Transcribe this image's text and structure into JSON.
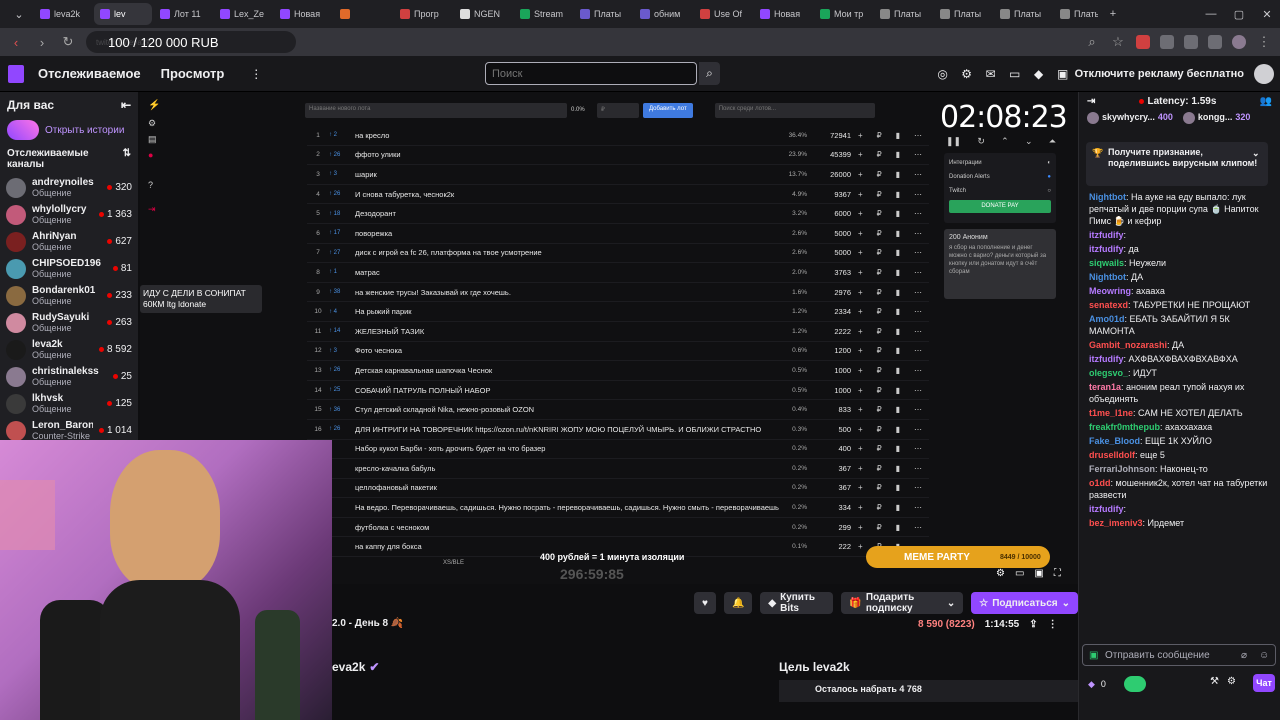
{
  "browser": {
    "tabs": [
      "leva2k",
      "lev",
      "Лот 11",
      "Lex_Ze",
      "Новая",
      "",
      "Прогр",
      "NGEN",
      "Stream",
      "Платы",
      "обним",
      "Use Of",
      "Новая",
      "Мои тр",
      "Платы",
      "Платы",
      "Платы",
      "Платы",
      "Платы",
      "Что хо"
    ],
    "address": "twitch.tv/leva2k",
    "overlay_title": "100 / 120 000 RUB",
    "new_tab": "+"
  },
  "nav": {
    "following": "Отслеживаемое",
    "browse": "Просмотр",
    "search_placeholder": "Поиск",
    "ad_free": "Отключите рекламу бесплатно"
  },
  "sidebar": {
    "for_you": "Для вас",
    "stories": "Открыть истории",
    "followed": "Отслеживаемые каналы",
    "channels": [
      {
        "name": "andreynoiles",
        "cat": "Общение",
        "viewers": "320",
        "color": "#6c6c74"
      },
      {
        "name": "whylollycry",
        "cat": "Общение",
        "viewers": "1 363",
        "color": "#c25a7a"
      },
      {
        "name": "AhriNyan",
        "cat": "Общение",
        "viewers": "627",
        "color": "#7a2020"
      },
      {
        "name": "CHIPSOED196",
        "cat": "Общение",
        "viewers": "81",
        "color": "#4a9ab0"
      },
      {
        "name": "Bondarenk01",
        "cat": "Общение",
        "viewers": "233",
        "color": "#8a6a40"
      },
      {
        "name": "RudySayuki",
        "cat": "Общение",
        "viewers": "263",
        "color": "#d08aa0"
      },
      {
        "name": "leva2k",
        "cat": "Общение",
        "viewers": "8 592",
        "color": "#1a1a1a"
      },
      {
        "name": "christinalekss",
        "cat": "Общение",
        "viewers": "25",
        "color": "#8a7a90"
      },
      {
        "name": "lkhvsk",
        "cat": "Общение",
        "viewers": "125",
        "color": "#3a3a3a"
      },
      {
        "name": "Leron_Baron",
        "cat": "Counter-Strike",
        "viewers": "1 014",
        "color": "#c05050"
      }
    ]
  },
  "stream_overlay": {
    "lot_input": "Название нового лота",
    "pct_default": "0.0%",
    "rub_placeholder": "₽",
    "add_lot": "Добавить лот",
    "lot_search": "Поиск среди лотов...",
    "lots": [
      {
        "n": "1",
        "mini": "↑ 2",
        "name": "на кресло",
        "pct": "36.4%",
        "amt": "72941"
      },
      {
        "n": "2",
        "mini": "↑ 26",
        "name": "ффото улики",
        "pct": "23.9%",
        "amt": "45399"
      },
      {
        "n": "3",
        "mini": "↑ 3",
        "name": "шарик",
        "pct": "13.7%",
        "amt": "26000"
      },
      {
        "n": "4",
        "mini": "↑ 26",
        "name": "И снова табуретка, чеснок2к",
        "pct": "4.9%",
        "amt": "9367"
      },
      {
        "n": "5",
        "mini": "↑ 18",
        "name": "Дезодорант",
        "pct": "3.2%",
        "amt": "6000"
      },
      {
        "n": "6",
        "mini": "↑ 17",
        "name": " поворежка",
        "pct": "2.6%",
        "amt": "5000"
      },
      {
        "n": "7",
        "mini": "↑ 27",
        "name": "диск с игрой еа fc 26, платформа на твое усмотрение",
        "pct": "2.6%",
        "amt": "5000"
      },
      {
        "n": "8",
        "mini": "↑ 1",
        "name": "матрас",
        "pct": "2.0%",
        "amt": "3763"
      },
      {
        "n": "9",
        "mini": "↑ 38",
        "name": "на женские трусы! Заказывай их где хочешь.",
        "pct": "1.6%",
        "amt": "2976"
      },
      {
        "n": "10",
        "mini": "↑ 4",
        "name": "На рыжий парик",
        "pct": "1.2%",
        "amt": "2334"
      },
      {
        "n": "11",
        "mini": "↑ 14",
        "name": "ЖЕЛЕЗНЫЙ ТАЗИК",
        "pct": "1.2%",
        "amt": "2222"
      },
      {
        "n": "12",
        "mini": "↑ 3",
        "name": "Фото чеснока",
        "pct": "0.6%",
        "amt": "1200"
      },
      {
        "n": "13",
        "mini": "↑ 26",
        "name": "Детская карнавальная шапочка Чеснок",
        "pct": "0.5%",
        "amt": "1000"
      },
      {
        "n": "14",
        "mini": "↑ 25",
        "name": "СОБАЧИЙ ПАТРУЛЬ ПОЛНЫЙ НАБОР",
        "pct": "0.5%",
        "amt": "1000"
      },
      {
        "n": "15",
        "mini": "↑ 36",
        "name": "Стул детский складной Nika, нежно-розовый OZON",
        "pct": "0.4%",
        "amt": "833"
      },
      {
        "n": "16",
        "mini": "↑ 26",
        "name": "ДЛЯ ИНТРИГИ НА ТОВОРЕЧНИК https://ozon.ru/t/nKNRIRI ЖОПУ МОЮ ПОЦЕЛУЙ ЧМЫРЬ. И ОБЛИЖИ СТРАСТНО",
        "pct": "0.3%",
        "amt": "500"
      },
      {
        "n": "17",
        "mini": "",
        "name": "Набор кукол Барби - хоть дрочить будет на что бразер",
        "pct": "0.2%",
        "amt": "400"
      },
      {
        "n": "18",
        "mini": "",
        "name": "кресло-качалка бабуль",
        "pct": "0.2%",
        "amt": "367"
      },
      {
        "n": "19",
        "mini": "",
        "name": "целлофановый пакетик",
        "pct": "0.2%",
        "amt": "367"
      },
      {
        "n": "20",
        "mini": "",
        "name": "На ведро. Переворачиваешь, садишься. Нужно посрать - переворачиваешь, садишься. Нужно смыть - переворачиваешь",
        "pct": "0.2%",
        "amt": "334"
      },
      {
        "n": "21",
        "mini": "",
        "name": "футболка с чесноком",
        "pct": "0.2%",
        "amt": "299"
      },
      {
        "n": "22",
        "mini": "",
        "name": "на каппу для бокса",
        "pct": "0.1%",
        "amt": "222"
      }
    ],
    "timer": "02:08:23",
    "interactions": "Интеграции",
    "donation_alerts": "Donation Alerts",
    "twitch": "Twitch",
    "donate_pay": "DONATE PAY",
    "auction_title": "200 Аноним",
    "auction_text": "я сбор на пополнение и денег можно с варио? деньги который за кнопку или донатом идут в счёт сборам",
    "tooltip": "ИДУ С ДЕЛИ В СОНИПАТ 60КМ ltg ldonate",
    "isolation": "400 рублей = 1 минута изоляции",
    "meme_party": "MEME PARTY",
    "meme_progress": "8449 / 10000",
    "xs_label": "XS/BLE",
    "big_progress": "296:59:85"
  },
  "info": {
    "title_snip": "2.0 - День 8 🍂",
    "channel": "eva2k",
    "buy_bits": "Купить Bits",
    "gift_sub": "Подарить подписку",
    "subscribe": "Подписаться",
    "viewers": "8 590 (8223)",
    "uptime": "1:14:55",
    "goal": "Цель leva2k",
    "goal_left": "Осталось набрать 4 768"
  },
  "chat": {
    "latency": "Latency: 1.59s",
    "top": [
      {
        "name": "skywhycry...",
        "val": "400"
      },
      {
        "name": "kongg...",
        "val": "320"
      }
    ],
    "promo": "Получите признание, поделившись вирусным клипом!",
    "messages": [
      {
        "u": "Nightbot",
        "c": "#4a90e2",
        "t": "На ауке на еду выпало: лук репчатый и две порции супа 🍵 Напиток Пимс 🍺 и кефир"
      },
      {
        "u": "itzfudify",
        "c": "#b57aff",
        "t": ""
      },
      {
        "u": "itzfudify",
        "c": "#b57aff",
        "t": "да"
      },
      {
        "u": "siqwails",
        "c": "#2ecc71",
        "t": "Неужели"
      },
      {
        "u": "Nightbot",
        "c": "#4a90e2",
        "t": "ДА"
      },
      {
        "u": "Meowring",
        "c": "#b57aff",
        "t": "ахааха"
      },
      {
        "u": "senatexd",
        "c": "#ff4f4f",
        "t": "ТАБУРЕТКИ НЕ ПРОЩАЮТ"
      },
      {
        "u": "Amo01d",
        "c": "#4a90e2",
        "t": "ЕБАТЬ ЗАБАЙТИЛ Я 5К МАМОНТА"
      },
      {
        "u": "Gambit_nozarashi",
        "c": "#ff4f4f",
        "t": "ДА"
      },
      {
        "u": "itzfudify",
        "c": "#b57aff",
        "t": "АХФВАХФВАХФВХАВФХА"
      },
      {
        "u": "olegsvo_",
        "c": "#2ecc71",
        "t": "ИДУТ"
      },
      {
        "u": "teran1a",
        "c": "#ff7aa8",
        "t": "аноним реал тупой нахуя их объединять"
      },
      {
        "u": "t1me_l1ne",
        "c": "#ff4f4f",
        "t": "САМ НЕ ХОТЕЛ ДЕЛАТЬ"
      },
      {
        "u": "freakfr0mthepub",
        "c": "#2ecc71",
        "t": "ахаххахаха"
      },
      {
        "u": "Fake_Blood",
        "c": "#4a90e2",
        "t": "ЕЩЕ 1К ХУЙЛО"
      },
      {
        "u": "druselldolf",
        "c": "#ff4f4f",
        "t": "еще 5"
      },
      {
        "u": "FerrariJohnson",
        "c": "#adadb8",
        "t": "Наконец-то"
      },
      {
        "u": "o1dd",
        "c": "#ff4f4f",
        "t": "мошенник2к, хотел чат на табуретки развести"
      },
      {
        "u": "itzfudify",
        "c": "#b57aff",
        "t": ""
      },
      {
        "u": "bez_imeniv3",
        "c": "#ff4f4f",
        "t": "Ирдемет"
      }
    ],
    "send": "Отправить сообщение",
    "points": "0",
    "chat_btn": "Чат"
  }
}
